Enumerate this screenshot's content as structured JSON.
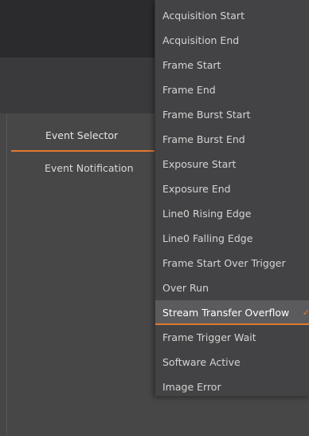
{
  "properties": {
    "event_selector": "Event Selector",
    "event_notification": "Event Notification"
  },
  "dropdown": {
    "selected_index": 12,
    "selected_mark": "✓",
    "items": [
      "Acquisition Start",
      "Acquisition End",
      "Frame Start",
      "Frame End",
      "Frame Burst Start",
      "Frame Burst End",
      "Exposure Start",
      "Exposure End",
      "Line0 Rising Edge",
      "Line0 Falling Edge",
      "Frame Start Over Trigger",
      "Over Run",
      "Stream Transfer Overflow",
      "Frame Trigger Wait",
      "Software Active",
      "Image Error"
    ]
  },
  "colors": {
    "accent": "#e0792f",
    "panel": "#474747",
    "menu": "#434345",
    "top_bar": "#2b2b2e"
  }
}
